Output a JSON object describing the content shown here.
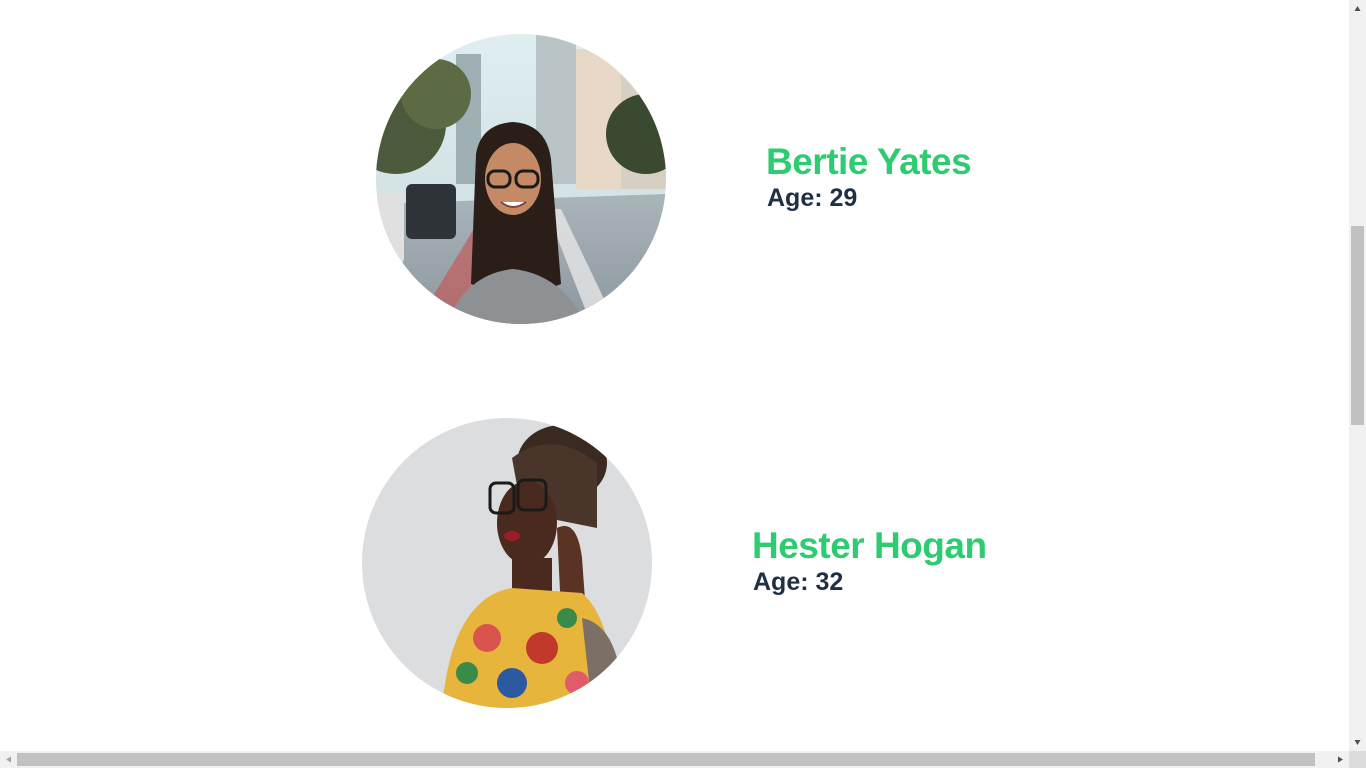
{
  "colors": {
    "name_color": "#2ecc71",
    "age_color": "#1f3044",
    "background": "#ffffff"
  },
  "profiles": [
    {
      "name": "Bertie Yates",
      "age_label": "Age: 29",
      "photo": "portrait-woman-glasses-city-street"
    },
    {
      "name": "Hester Hogan",
      "age_label": "Age: 32",
      "photo": "portrait-woman-glasses-floral-top"
    }
  ],
  "scrollbars": {
    "vertical": {
      "up_icon": "arrow-up-icon",
      "down_icon": "arrow-down-icon"
    },
    "horizontal": {
      "left_icon": "arrow-left-icon",
      "right_icon": "arrow-right-icon"
    }
  }
}
